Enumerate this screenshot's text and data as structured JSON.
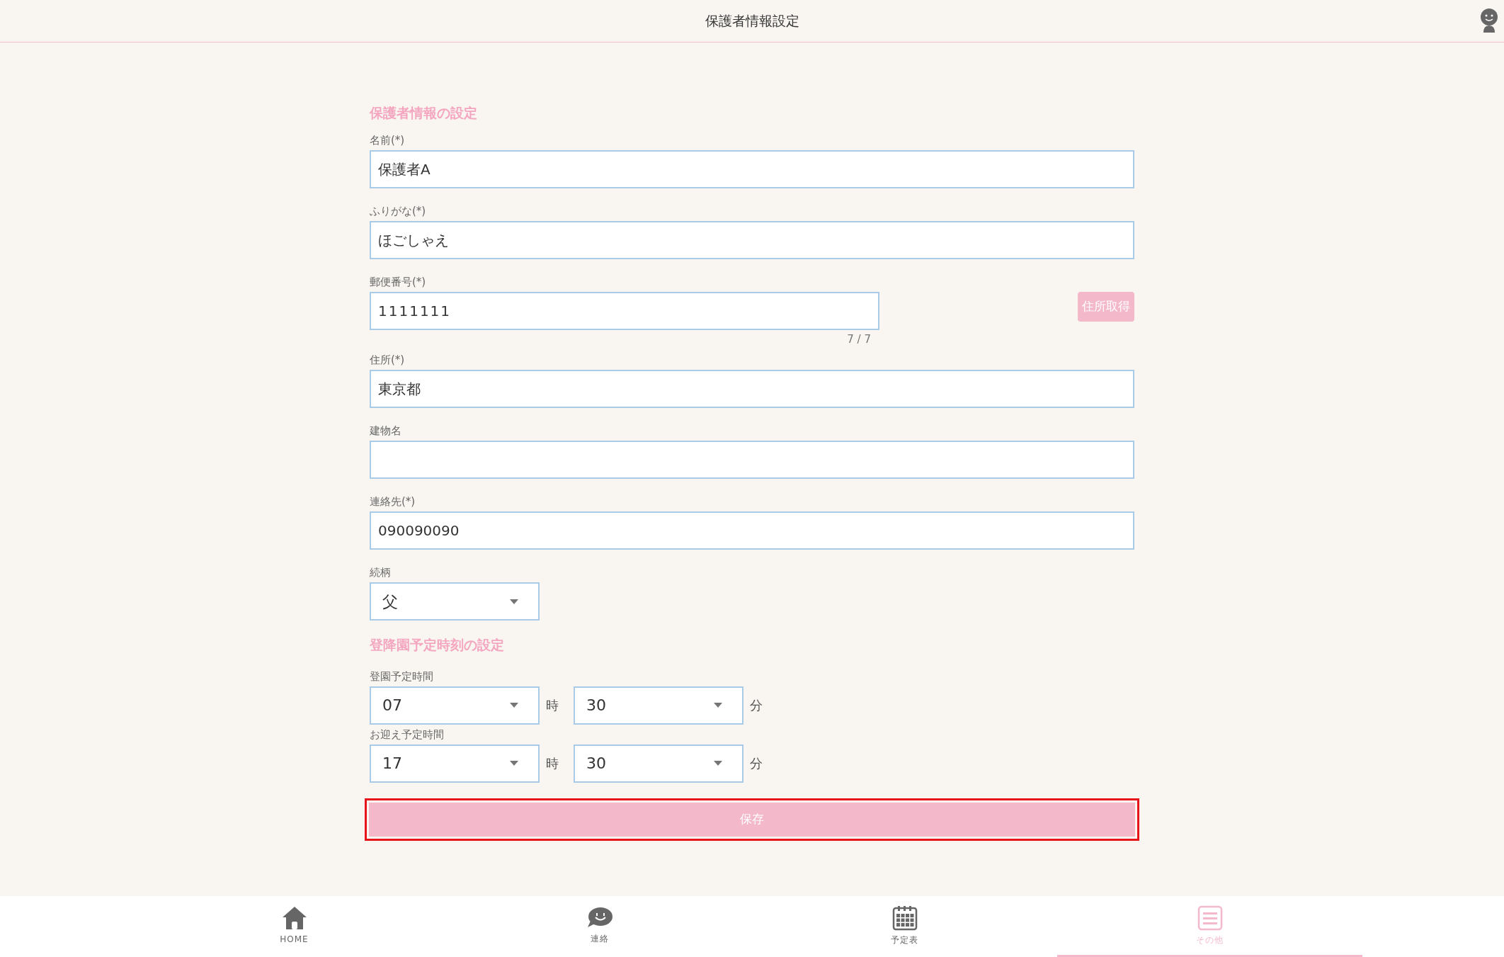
{
  "header": {
    "title": "保護者情報設定"
  },
  "sections": [
    {
      "title": "保護者情報の設定",
      "fields": [
        {
          "kind": "text",
          "label": "名前(*)",
          "value": "保護者A"
        },
        {
          "kind": "text",
          "label": "ふりがな(*)",
          "value": "ほごしゃえ"
        },
        {
          "kind": "postal",
          "label": "郵便番号(*)",
          "value": "1111111",
          "counter": "7 / 7",
          "button": "住所取得"
        },
        {
          "kind": "text",
          "label": "住所(*)",
          "value": "東京都"
        },
        {
          "kind": "text",
          "label": "建物名"
        },
        {
          "kind": "text",
          "label": "連絡先(*)",
          "value": "090090090"
        },
        {
          "kind": "select",
          "label": "続柄",
          "value": "父"
        }
      ]
    },
    {
      "title": "登降園予定時刻の設定",
      "fields": [
        {
          "kind": "time",
          "label": "登園予定時間",
          "hour": "07",
          "hour_unit": "時",
          "minute": "30",
          "minute_unit": "分"
        },
        {
          "kind": "time",
          "label": "お迎え予定時間",
          "hour": "17",
          "hour_unit": "時",
          "minute": "30",
          "minute_unit": "分"
        }
      ]
    }
  ],
  "save_button": {
    "label": "保存",
    "highlighted": true
  },
  "nav": [
    {
      "kind": "home",
      "label": "HOME",
      "selected": false
    },
    {
      "kind": "chat",
      "label": "連絡",
      "selected": false
    },
    {
      "kind": "calendar",
      "label": "予定表",
      "selected": false
    },
    {
      "kind": "menu",
      "label": "その他",
      "selected": true
    }
  ]
}
